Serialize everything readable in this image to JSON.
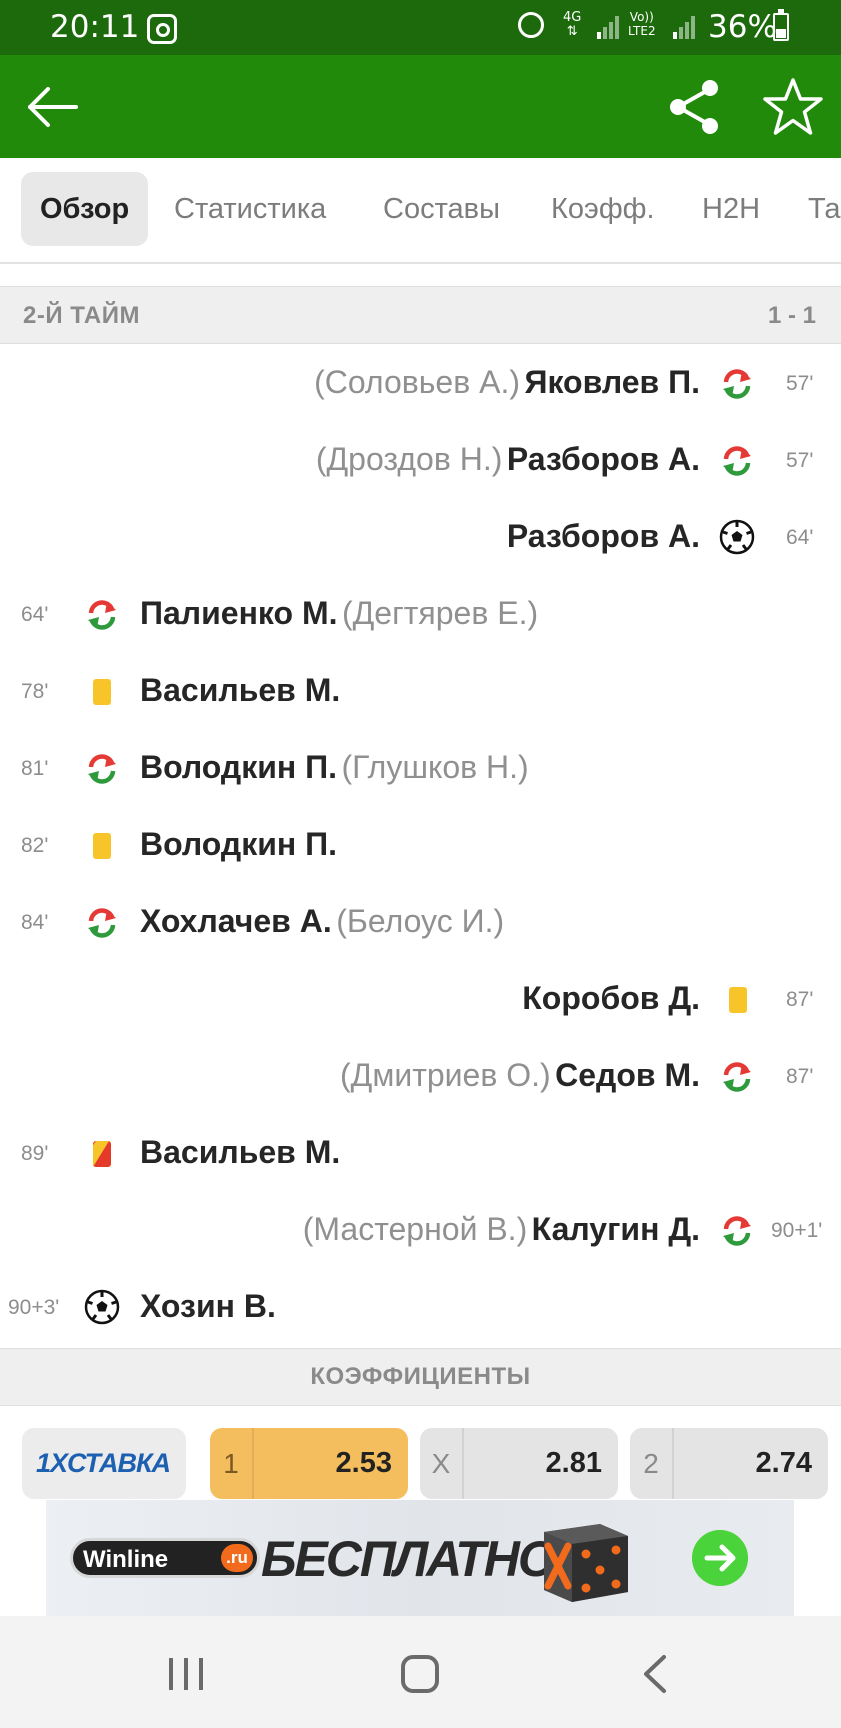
{
  "status_bar": {
    "time": "20:11",
    "network_type": "4G",
    "volte_label_1": "Vo))",
    "volte_label_2": "LTE2",
    "battery": "36%"
  },
  "tabs": [
    "Обзор",
    "Статистика",
    "Составы",
    "Коэфф.",
    "H2H",
    "Та"
  ],
  "section": {
    "title": "2-Й ТАЙМ",
    "score": "1 - 1"
  },
  "events": [
    {
      "side": "away",
      "minute": "57'",
      "icon": "substitution-icon",
      "player": "Яковлев П.",
      "alt": "(Соловьев А.)"
    },
    {
      "side": "away",
      "minute": "57'",
      "icon": "substitution-icon",
      "player": "Разборов А.",
      "alt": "(Дроздов Н.)"
    },
    {
      "side": "away",
      "minute": "64'",
      "icon": "goal-ball-icon",
      "player": "Разборов А.",
      "alt": ""
    },
    {
      "side": "home",
      "minute": "64'",
      "icon": "substitution-icon",
      "player": "Палиенко М.",
      "alt": "(Дегтярев Е.)"
    },
    {
      "side": "home",
      "minute": "78'",
      "icon": "yellow-card-icon",
      "player": "Васильев М.",
      "alt": ""
    },
    {
      "side": "home",
      "minute": "81'",
      "icon": "substitution-icon",
      "player": "Володкин П.",
      "alt": "(Глушков Н.)"
    },
    {
      "side": "home",
      "minute": "82'",
      "icon": "yellow-card-icon",
      "player": "Володкин П.",
      "alt": ""
    },
    {
      "side": "home",
      "minute": "84'",
      "icon": "substitution-icon",
      "player": "Хохлачев А.",
      "alt": "(Белоус И.)"
    },
    {
      "side": "away",
      "minute": "87'",
      "icon": "yellow-card-icon",
      "player": "Коробов Д.",
      "alt": ""
    },
    {
      "side": "away",
      "minute": "87'",
      "icon": "substitution-icon",
      "player": "Седов М.",
      "alt": "(Дмитриев О.)"
    },
    {
      "side": "home",
      "minute": "89'",
      "icon": "second-yellow-card-icon",
      "player": "Васильев М.",
      "alt": ""
    },
    {
      "side": "away",
      "minute": "90+1'",
      "icon": "substitution-icon",
      "player": "Калугин Д.",
      "alt": "(Мастерной В.)"
    },
    {
      "side": "home",
      "minute": "90+3'",
      "icon": "goal-ball-icon",
      "player": "Хозин В.",
      "alt": ""
    }
  ],
  "odds": {
    "header": "КОЭФФИЦИЕНТЫ",
    "bookmaker": "1XСТАВКА",
    "items": [
      {
        "label": "1",
        "value": "2.53",
        "highlight": true
      },
      {
        "label": "X",
        "value": "2.81",
        "highlight": false
      },
      {
        "label": "2",
        "value": "2.74",
        "highlight": false
      }
    ]
  },
  "banner": {
    "brand": "Winline",
    "brand_suffix": ".ru",
    "text": "БЕСПЛАТНО"
  },
  "colors": {
    "status_bar": "#1d6a0d",
    "app_bar": "#228a0b",
    "substitution_red": "#e53935",
    "substitution_green": "#2e9a3c",
    "yellow_card": "#f7c52a",
    "red_card": "#e53a2a",
    "odds_highlight": "#f4bd5e",
    "bookmaker_blue": "#1d5fb0"
  }
}
